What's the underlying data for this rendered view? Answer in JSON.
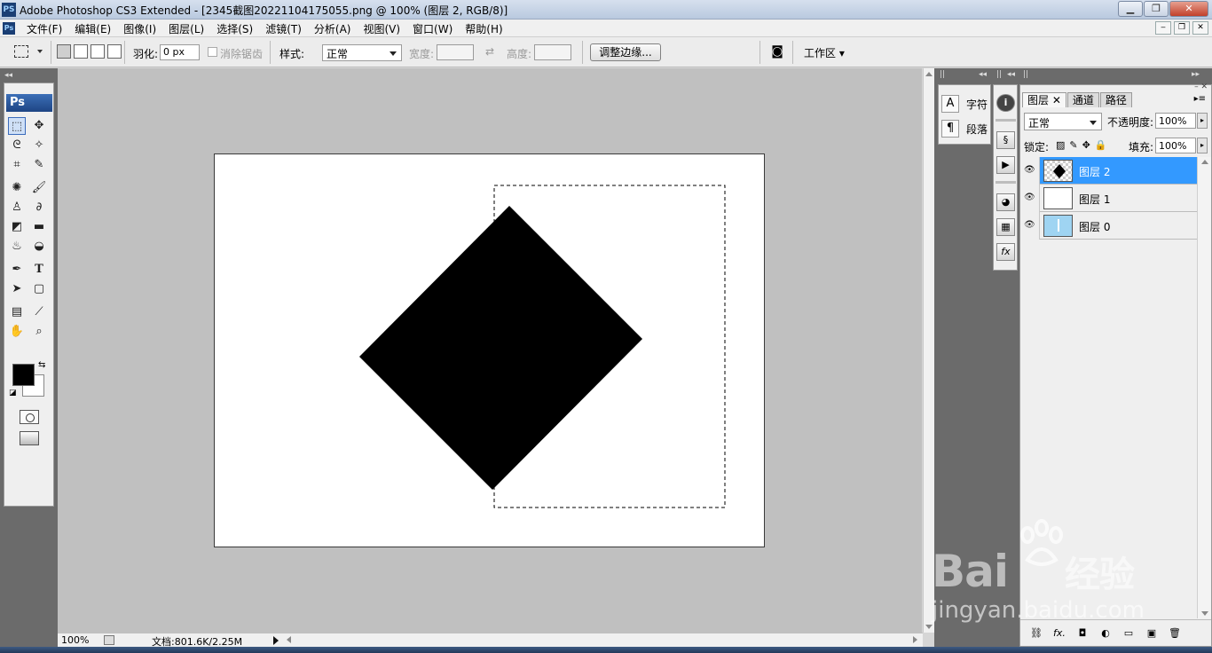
{
  "window": {
    "app_icon": "PS",
    "title": "Adobe Photoshop CS3 Extended - [2345截图20221104175055.png @ 100% (图层 2, RGB/8)]",
    "controls": [
      "minimize-icon",
      "maximize-icon",
      "close-icon"
    ]
  },
  "menubar": {
    "items": [
      "文件(F)",
      "编辑(E)",
      "图像(I)",
      "图层(L)",
      "选择(S)",
      "滤镜(T)",
      "分析(A)",
      "视图(V)",
      "窗口(W)",
      "帮助(H)"
    ]
  },
  "options": {
    "feather_label": "羽化:",
    "feather_value": "0 px",
    "antialias_label": "消除锯齿",
    "style_label": "样式:",
    "style_value": "正常",
    "width_label": "宽度:",
    "height_label": "高度:",
    "refine_edge": "调整边缘...",
    "workspace": "工作区"
  },
  "toolbox": {
    "logo": "Ps",
    "fg_color": "#000000",
    "bg_color": "#ffffff"
  },
  "status": {
    "zoom": "100%",
    "doc_info": "文档:801.6K/2.25M"
  },
  "char_panel": {
    "character": "字符",
    "paragraph": "段落"
  },
  "layers_panel": {
    "tabs": [
      "图层",
      "通道",
      "路径"
    ],
    "blend_mode": "正常",
    "opacity_label": "不透明度:",
    "opacity_value": "100%",
    "lock_label": "锁定:",
    "fill_label": "填充:",
    "fill_value": "100%",
    "layers": [
      {
        "name": "图层 2",
        "selected": true
      },
      {
        "name": "图层 1",
        "selected": false
      },
      {
        "name": "图层 0",
        "selected": false
      }
    ],
    "selection_color": "#3399ff"
  },
  "watermark": {
    "logo": "Bai",
    "logo_suffix": "经验",
    "url": "jingyan.baidu.com"
  }
}
